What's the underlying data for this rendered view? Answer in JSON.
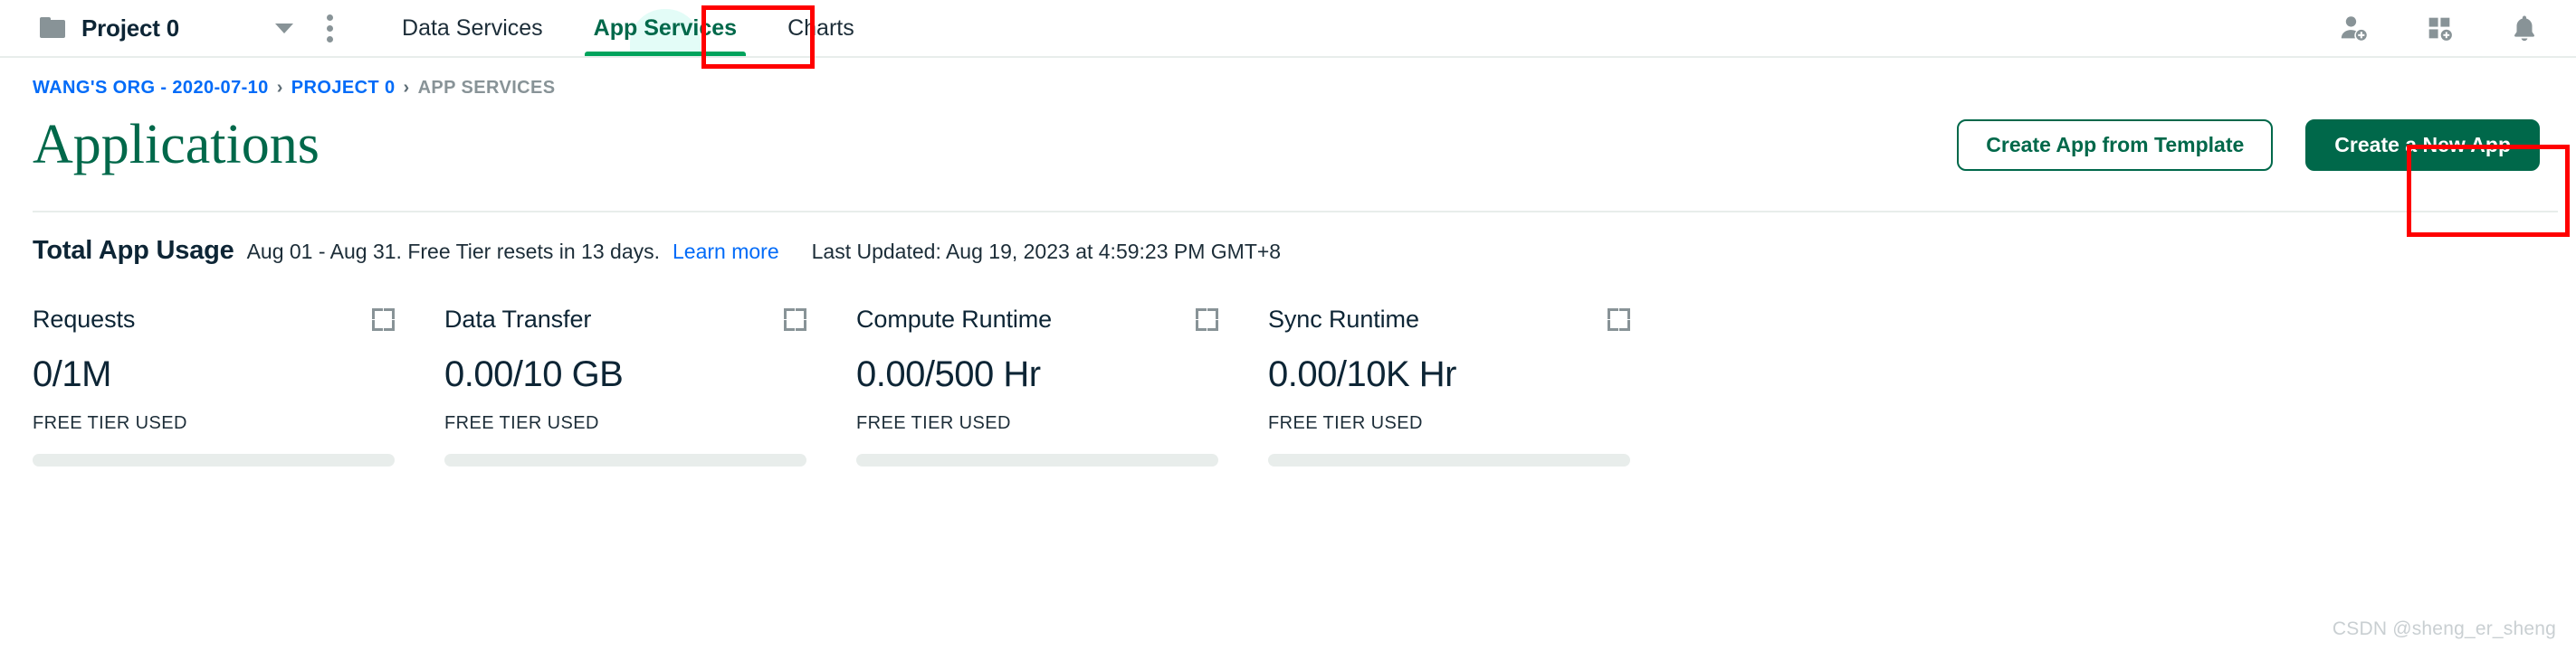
{
  "topnav": {
    "project_name": "Project 0",
    "folder_icon": "folder-icon",
    "caret_icon": "chevron-down-icon",
    "kebab_icon": "more-vertical-icon",
    "tabs": [
      {
        "label": "Data Services",
        "active": false
      },
      {
        "label": "App Services",
        "active": true
      },
      {
        "label": "Charts",
        "active": false
      }
    ],
    "right_icons": [
      {
        "name": "invite-user-icon"
      },
      {
        "name": "access-manager-icon"
      },
      {
        "name": "bell-icon"
      }
    ]
  },
  "breadcrumb": {
    "items": [
      {
        "label": "WANG'S ORG - 2020-07-10",
        "current": false
      },
      {
        "label": "PROJECT 0",
        "current": false
      },
      {
        "label": "APP SERVICES",
        "current": true
      }
    ],
    "separator": "›"
  },
  "header": {
    "title": "Applications",
    "create_from_template_label": "Create App from Template",
    "create_new_app_label": "Create a New App"
  },
  "usage": {
    "title": "Total App Usage",
    "period": "Aug 01 - Aug 31. Free Tier resets in 13 days.",
    "learn_more": "Learn more",
    "last_updated": "Last Updated: Aug 19, 2023 at 4:59:23 PM GMT+8",
    "free_tier_label": "FREE TIER USED",
    "metrics": [
      {
        "name": "Requests",
        "value": "0/1M",
        "label": "FREE TIER USED",
        "progress": 0
      },
      {
        "name": "Data Transfer",
        "value": "0.00/10 GB",
        "label": "FREE TIER USED",
        "progress": 0
      },
      {
        "name": "Compute Runtime",
        "value": "0.00/500 Hr",
        "label": "FREE TIER USED",
        "progress": 0
      },
      {
        "name": "Sync Runtime",
        "value": "0.00/10K Hr",
        "label": "FREE TIER USED",
        "progress": 0
      }
    ]
  },
  "watermark": "CSDN @sheng_er_sheng",
  "colors": {
    "brand_green": "#00684a",
    "accent_green": "#00a35c",
    "link_blue": "#016bf8",
    "highlight_red": "#ff0000",
    "tab_highlight": "#e3fcf7",
    "text_dark": "#0d2535",
    "text_muted": "#889397",
    "bar_track": "#e8edeb"
  }
}
